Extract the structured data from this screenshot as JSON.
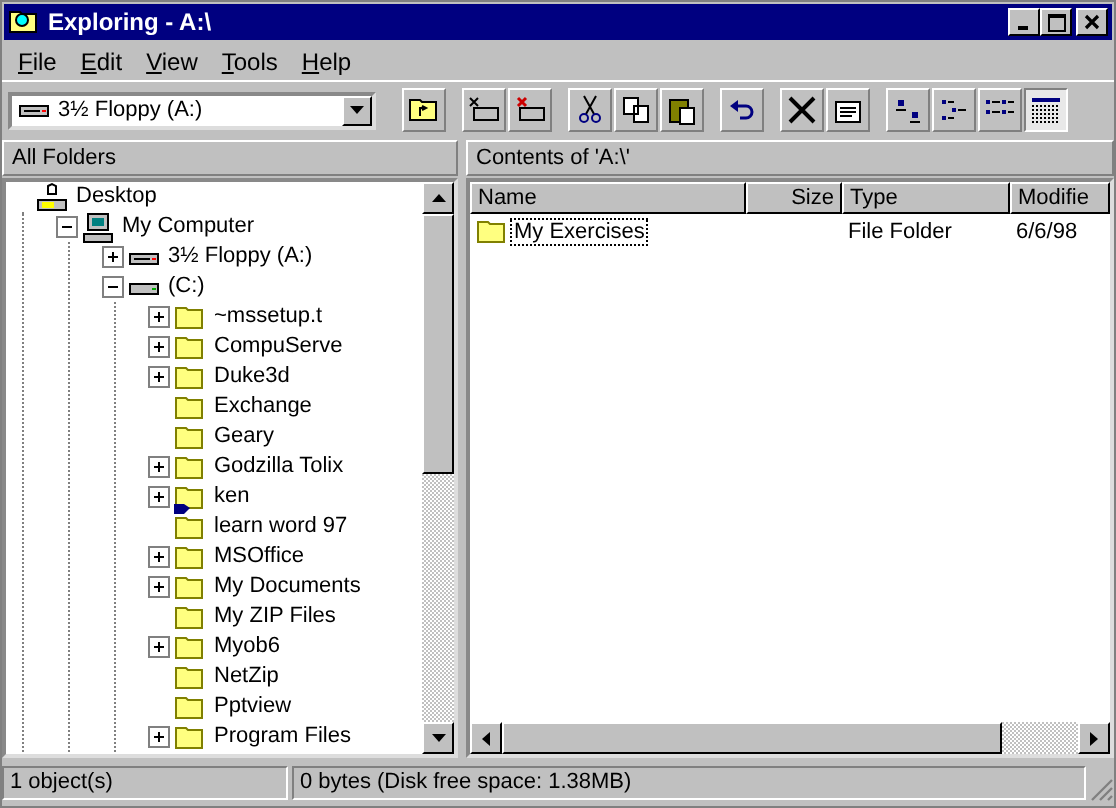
{
  "window": {
    "title": "Exploring - A:\\"
  },
  "menu": [
    "File",
    "Edit",
    "View",
    "Tools",
    "Help"
  ],
  "address": {
    "value": "3½ Floppy (A:)"
  },
  "views": [
    {
      "selected": false
    },
    {
      "selected": false
    },
    {
      "selected": false
    },
    {
      "selected": true
    }
  ],
  "left_header": "All Folders",
  "right_header": "Contents of 'A:\\'",
  "tree": [
    {
      "label": "Desktop",
      "kind": "desktop",
      "children": [
        {
          "label": "My Computer",
          "kind": "computer",
          "expanded": true,
          "has_children": true,
          "children": [
            {
              "label": "3½ Floppy (A:)",
              "kind": "floppy",
              "expanded": false,
              "has_children": true
            },
            {
              "label": "(C:)",
              "kind": "drive",
              "expanded": true,
              "has_children": true,
              "children": [
                {
                  "label": "~mssetup.t",
                  "kind": "folder",
                  "expanded": false,
                  "has_children": true
                },
                {
                  "label": "CompuServe",
                  "kind": "folder",
                  "expanded": false,
                  "has_children": true
                },
                {
                  "label": "Duke3d",
                  "kind": "folder",
                  "expanded": false,
                  "has_children": true
                },
                {
                  "label": "Exchange",
                  "kind": "folder",
                  "expanded": false,
                  "has_children": false
                },
                {
                  "label": "Geary",
                  "kind": "folder",
                  "expanded": false,
                  "has_children": false
                },
                {
                  "label": "Godzilla Tolix",
                  "kind": "folder",
                  "expanded": false,
                  "has_children": true
                },
                {
                  "label": "ken",
                  "kind": "folder",
                  "expanded": false,
                  "has_children": true,
                  "shared": true
                },
                {
                  "label": "learn word 97",
                  "kind": "folder",
                  "expanded": false,
                  "has_children": false
                },
                {
                  "label": "MSOffice",
                  "kind": "folder",
                  "expanded": false,
                  "has_children": true
                },
                {
                  "label": "My Documents",
                  "kind": "folder",
                  "expanded": false,
                  "has_children": true
                },
                {
                  "label": "My ZIP Files",
                  "kind": "folder",
                  "expanded": false,
                  "has_children": false
                },
                {
                  "label": "Myob6",
                  "kind": "folder",
                  "expanded": false,
                  "has_children": true
                },
                {
                  "label": "NetZip",
                  "kind": "folder",
                  "expanded": false,
                  "has_children": false
                },
                {
                  "label": "Pptview",
                  "kind": "folder",
                  "expanded": false,
                  "has_children": false
                },
                {
                  "label": "Program Files",
                  "kind": "folder",
                  "expanded": false,
                  "has_children": true
                }
              ]
            }
          ]
        }
      ]
    }
  ],
  "table": {
    "columns": [
      "Name",
      "Size",
      "Type",
      "Modifie"
    ],
    "rows": [
      {
        "name": "My Exercises",
        "size": "",
        "type": "File Folder",
        "modified": "6/6/98",
        "selected": true
      }
    ]
  },
  "status_bar": [
    "1 object(s)",
    "0 bytes (Disk free space: 1.38MB)"
  ]
}
